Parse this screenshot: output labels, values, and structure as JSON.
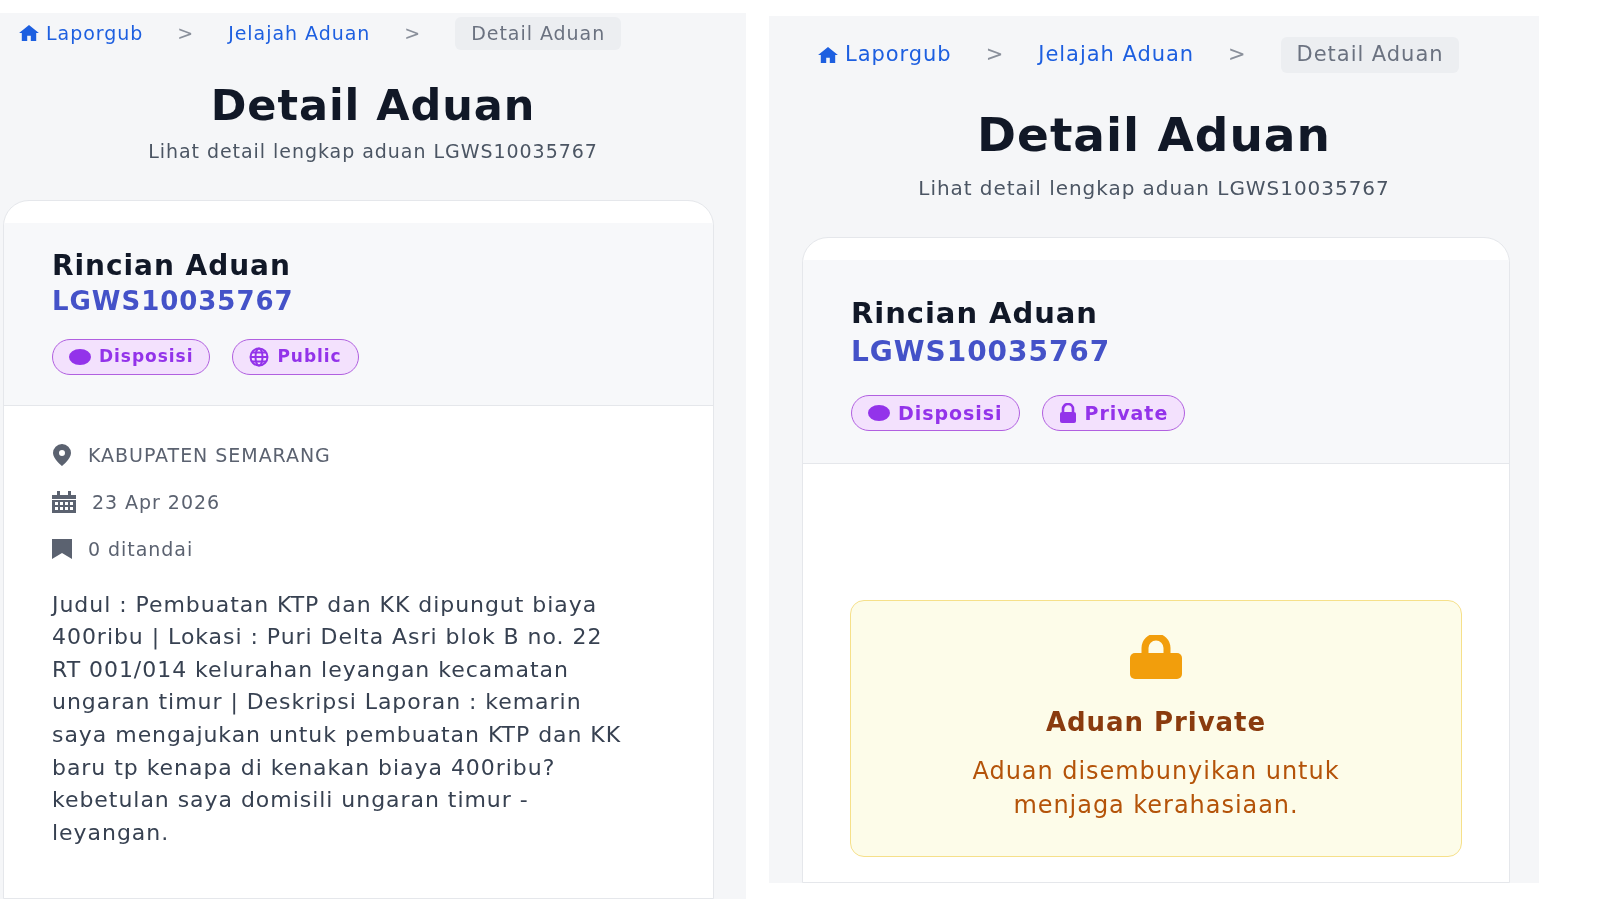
{
  "panels": [
    {
      "breadcrumb": {
        "separator": ">",
        "items": [
          {
            "label": "Laporgub",
            "kind": "home"
          },
          {
            "label": "Jelajah Aduan",
            "kind": "link"
          },
          {
            "label": "Detail Aduan",
            "kind": "current"
          }
        ]
      },
      "title": "Detail Aduan",
      "subtitle": "Lihat detail lengkap aduan LGWS10035767",
      "card": {
        "heading": "Rincian Aduan",
        "code": "LGWS10035767",
        "badges": [
          {
            "label": "Disposisi",
            "kind": "status"
          },
          {
            "label": "Public",
            "kind": "public"
          }
        ],
        "details": [
          {
            "kind": "location",
            "text": "KABUPATEN SEMARANG"
          },
          {
            "kind": "date",
            "text": "23 Apr 2026"
          },
          {
            "kind": "bookmark",
            "text": "0 ditandai"
          }
        ],
        "description": "Judul : Pembuatan KTP dan KK dipungut biaya 400ribu | Lokasi : Puri Delta Asri blok B no. 22 RT 001/014 kelurahan leyangan kecamatan ungaran timur | Deskripsi Laporan : kemarin saya mengajukan untuk pembuatan KTP dan KK baru tp kenapa di kenakan biaya 400ribu? kebetulan saya domisili ungaran timur - leyangan."
      }
    },
    {
      "breadcrumb": {
        "separator": ">",
        "items": [
          {
            "label": "Laporgub",
            "kind": "home"
          },
          {
            "label": "Jelajah Aduan",
            "kind": "link"
          },
          {
            "label": "Detail Aduan",
            "kind": "current"
          }
        ]
      },
      "title": "Detail Aduan",
      "subtitle": "Lihat detail lengkap aduan LGWS10035767",
      "card": {
        "heading": "Rincian Aduan",
        "code": "LGWS10035767",
        "badges": [
          {
            "label": "Disposisi",
            "kind": "status"
          },
          {
            "label": "Private",
            "kind": "private"
          }
        ],
        "notice": {
          "title": "Aduan Private",
          "message": "Aduan disembunyikan untuk menjaga kerahasiaan."
        }
      }
    }
  ]
}
